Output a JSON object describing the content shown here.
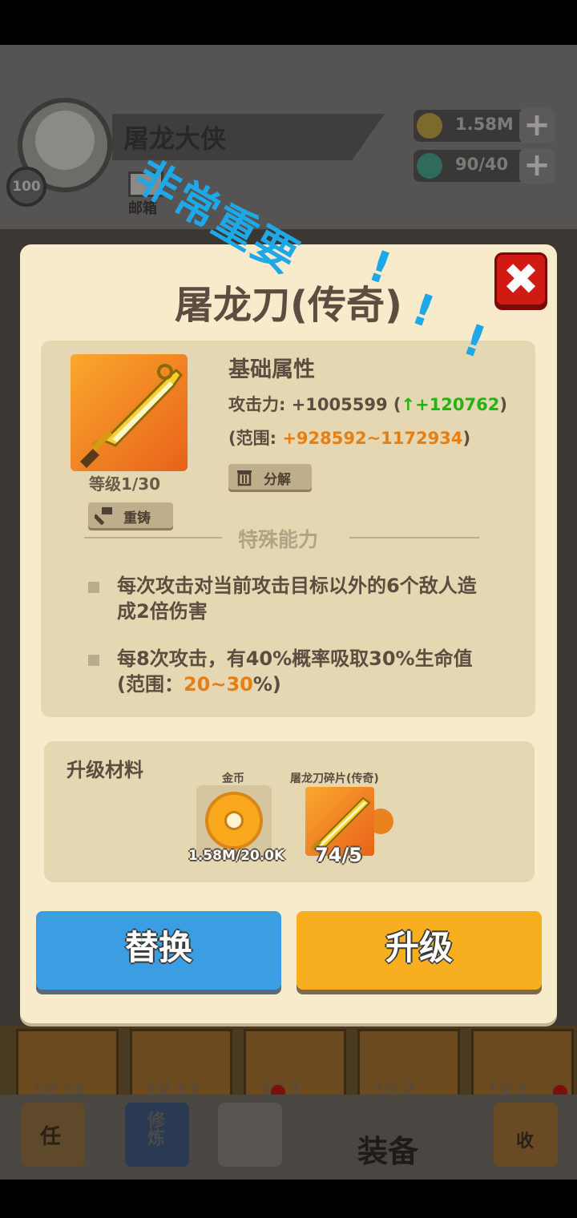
{
  "background": {
    "player_name": "屠龙大侠",
    "player_level": "100",
    "mail_label": "邮箱",
    "gold_amount": "1.58M",
    "gem_amount": "90/40",
    "card_levels": [
      "LV.16",
      "LV.13",
      "LV.1",
      "LV.2",
      "LV.1"
    ],
    "nav_items": [
      "任",
      "修炼",
      "装备",
      "收"
    ],
    "nav_active_label": "装备"
  },
  "overlay_text": {
    "main": "非常重要",
    "exclaims": [
      "!",
      "!",
      "!",
      "!"
    ]
  },
  "dialog": {
    "title": "屠龙刀(传奇)",
    "item": {
      "level_text": "等级1/30",
      "recast_label": "重铸",
      "decompose_label": "分解"
    },
    "base_attr": {
      "title": "基础属性",
      "attack_prefix": "攻击力: +1005599 (",
      "attack_bonus": "↑+120762",
      "attack_suffix": ")",
      "range_prefix": "(范围: ",
      "range_value": "+928592~1172934",
      "range_suffix": ")"
    },
    "special": {
      "title": "特殊能力",
      "ability_1": "每次攻击对当前攻击目标以外的6个敌人造成2倍伤害",
      "ability_2_prefix": "每8次攻击，有40%概率吸取30%生命值(范围：",
      "ability_2_range": "20~30",
      "ability_2_suffix": "%)"
    },
    "materials": {
      "title": "升级材料",
      "coin_label": "金币",
      "coin_count": "1.58M/20.0K",
      "shard_label": "屠龙刀碎片(传奇)",
      "shard_count": "74/5"
    },
    "buttons": {
      "replace": "替换",
      "upgrade": "升级"
    }
  },
  "colors": {
    "green_bonus": "#23b312",
    "orange_value": "#e67e12",
    "replace_button": "#3b9de2",
    "upgrade_button": "#f7ae1f",
    "close_button": "#d01a14",
    "annotation": "#1ea8e8"
  }
}
